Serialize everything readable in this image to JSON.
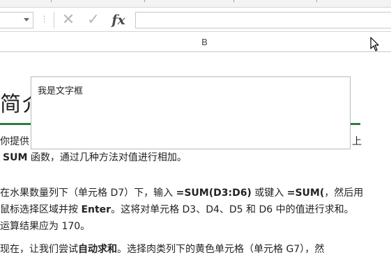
{
  "formula_bar": {
    "name_box_value": "",
    "cancel_icon": "close-icon",
    "enter_icon": "check-icon",
    "fx_label": "fx",
    "formula_value": ""
  },
  "column_header": {
    "label": "B"
  },
  "doc": {
    "heading": "简介",
    "line1_prefix": "你提供",
    "line1_suffix": "上",
    "line2_bold": "SUM",
    "line2_rest": " 函数，通过几种方法对值进行相加。",
    "para2_line1_a": "在水果数量列下（单元格 D7）下，输入 ",
    "para2_line1_b": "=SUM(D3:D6)",
    "para2_line1_c": " 或键入 ",
    "para2_line1_d": "=SUM(",
    "para2_line1_e": "，然后用",
    "para2_line2_a": "鼠标选择区域并按 ",
    "para2_line2_b": "Enter",
    "para2_line2_c": "。这将对单元格 D3、D4、D5 和 D6 中的值进行求和。",
    "para2_line3": "运算结果应为 170。",
    "para3_a": "现在，让我们尝试",
    "para3_b": "自动求和",
    "para3_c": "。选择肉类列下的黄色单元格（单元格 G7），然"
  },
  "textbox": {
    "text": "我是文字框"
  },
  "colors": {
    "accent_green": "#2f7d3b",
    "gridline": "#d4d4d4"
  }
}
